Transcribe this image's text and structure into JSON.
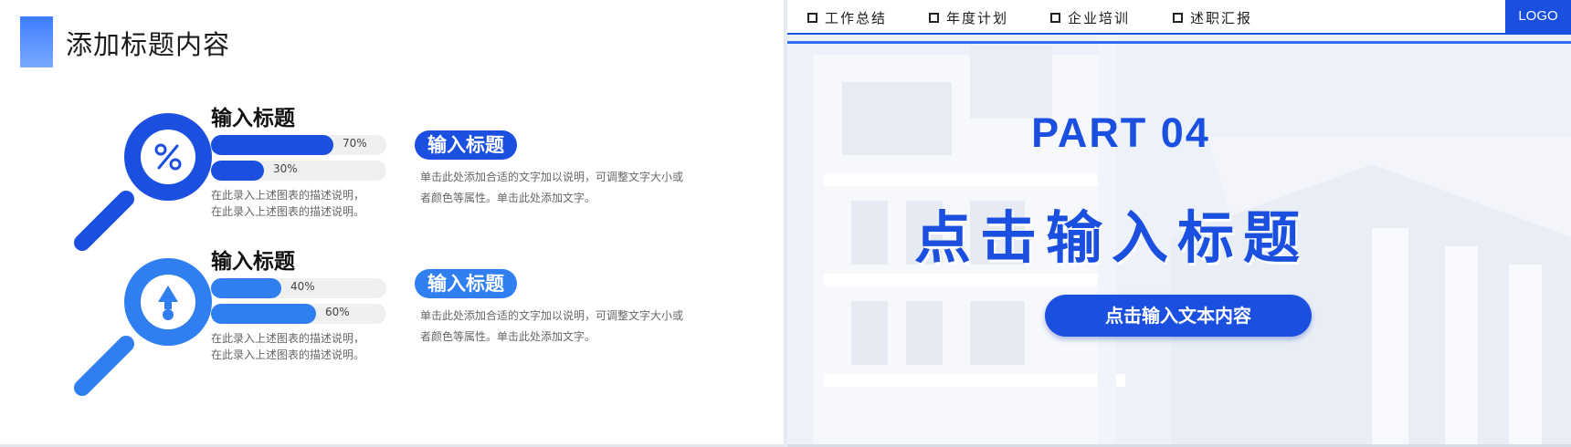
{
  "left": {
    "title": "添加标题内容",
    "items": [
      {
        "heading": "输入标题",
        "icon": "percent-icon",
        "color": "#1a4fe0",
        "bars": [
          {
            "label": "70%",
            "value": 0.7
          },
          {
            "label": "30%",
            "value": 0.3
          }
        ],
        "desc_lines": [
          "在此录入上述图表的描述说明，",
          "在此录入上述图表的描述说明。"
        ],
        "pill_heading": "输入标题",
        "pill_lines": [
          "单击此处添加合适的文字加以说明，可调整文字大小或",
          "者颜色等属性。单击此处添加文字。"
        ]
      },
      {
        "heading": "输入标题",
        "icon": "arrow-up-icon",
        "color": "#2f7ff0",
        "bars": [
          {
            "label": "40%",
            "value": 0.4
          },
          {
            "label": "60%",
            "value": 0.6
          }
        ],
        "desc_lines": [
          "在此录入上述图表的描述说明，",
          "在此录入上述图表的描述说明。"
        ],
        "pill_heading": "输入标题",
        "pill_lines": [
          "单击此处添加合适的文字加以说明，可调整文字大小或",
          "者颜色等属性。单击此处添加文字。"
        ]
      }
    ]
  },
  "right": {
    "nav": [
      "工作总结",
      "年度计划",
      "企业培训",
      "述职汇报"
    ],
    "logo": "LOGO",
    "part": "PART 04",
    "title": "点击输入标题",
    "button": "点击输入文本内容",
    "accent": "#1a4fe0"
  }
}
